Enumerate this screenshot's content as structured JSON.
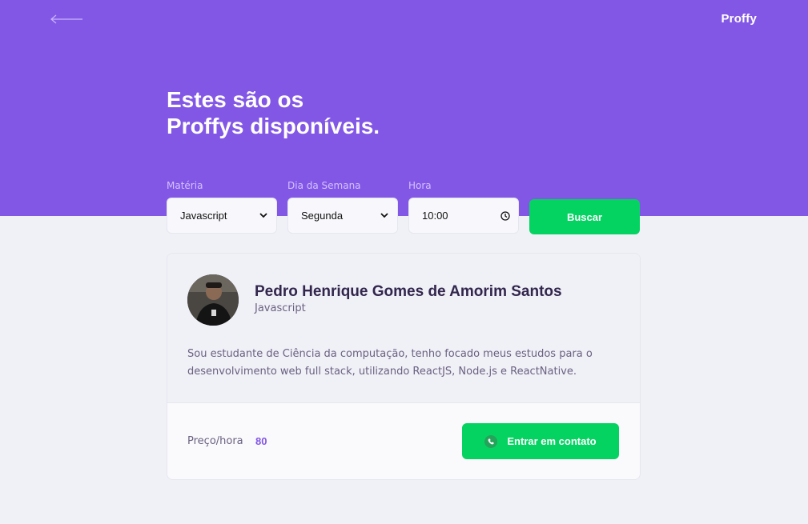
{
  "header": {
    "back_icon": "arrow-left-icon",
    "logo": "Proffy"
  },
  "title": {
    "line1": "Estes são os",
    "line2": "Proffys disponíveis."
  },
  "filters": {
    "subject": {
      "label": "Matéria",
      "value": "Javascript"
    },
    "week_day": {
      "label": "Dia da Semana",
      "value": "Segunda"
    },
    "time": {
      "label": "Hora",
      "value": "10:00"
    },
    "search_label": "Buscar"
  },
  "teacher": {
    "name": "Pedro Henrique Gomes de Amorim Santos",
    "subject": "Javascript",
    "bio": "Sou estudante de Ciência da computação, tenho focado meus estudos para o desenvolvimento web full stack, utilizando ReactJS, Node.js e ReactNative.",
    "price_label": "Preço/hora",
    "price_value": "80",
    "contact_label": "Entrar em contato"
  },
  "colors": {
    "primary": "#8257e5",
    "secondary": "#04d361",
    "background": "#f0f0f7"
  }
}
